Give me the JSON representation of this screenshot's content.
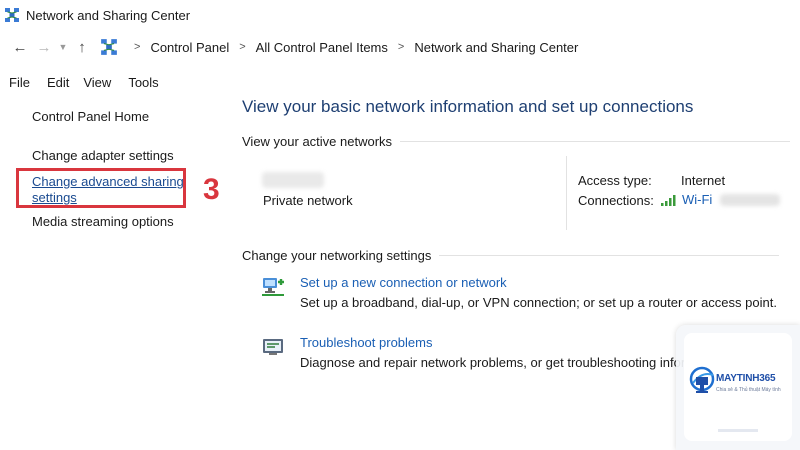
{
  "window": {
    "title": "Network and Sharing Center"
  },
  "nav": {
    "back_icon": "arrow-left-icon",
    "forward_icon": "arrow-right-icon",
    "recent_icon": "chevron-down-icon",
    "up_icon": "arrow-up-icon",
    "breadcrumb": [
      "Control Panel",
      "All Control Panel Items",
      "Network and Sharing Center"
    ],
    "separator": ">"
  },
  "menu": [
    "File",
    "Edit",
    "View",
    "Tools"
  ],
  "left": {
    "home": "Control Panel Home",
    "adapter": "Change adapter settings",
    "advanced": "Change advanced sharing settings",
    "media": "Media streaming options"
  },
  "annotation": {
    "step": "3",
    "color": "#d9363e"
  },
  "main": {
    "title": "View your basic network information and set up connections",
    "active_networks_heading": "View your active networks",
    "network_category": "Private network",
    "access_type_label": "Access type:",
    "access_type_value": "Internet",
    "connections_label": "Connections:",
    "connection_name": "Wi-Fi",
    "change_heading": "Change your networking settings",
    "tasks": [
      {
        "link": "Set up a new connection or network",
        "desc": "Set up a broadband, dial-up, or VPN connection; or set up a router or access point.",
        "icon": "network-setup-icon"
      },
      {
        "link": "Troubleshoot problems",
        "desc": "Diagnose and repair network problems, or get troubleshooting information.",
        "icon": "troubleshoot-icon"
      }
    ]
  },
  "watermark": {
    "brand": "MAYTINH365",
    "tagline": "Chia sẻ & Thủ thuật Máy tính"
  },
  "colors": {
    "title_blue": "#1e3f72",
    "link_blue": "#1a5fb4",
    "highlight_red": "#d9363e"
  }
}
